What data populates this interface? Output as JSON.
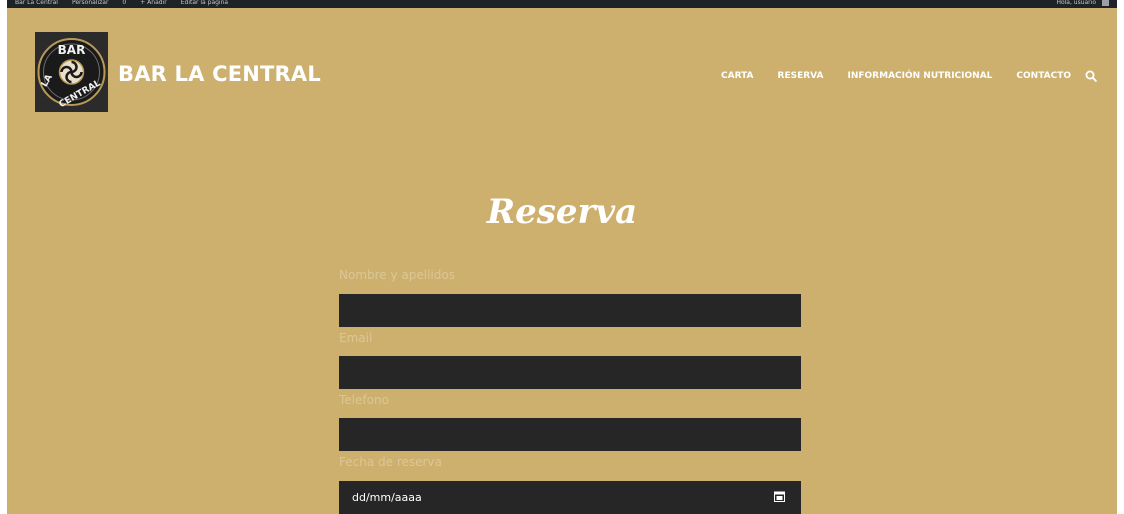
{
  "admin_bar": {
    "left_items": [
      "Bar La Central",
      "Personalizar",
      "0",
      "+ Añadir",
      "Editar la página"
    ],
    "right_text": "Hola, usuario"
  },
  "header": {
    "site_title": "BAR LA CENTRAL",
    "logo_text": "BAR LA CENTRAL",
    "nav": {
      "carta": "CARTA",
      "reserva": "RESERVA",
      "nutricional": "INFORMACIÓN NUTRICIONAL",
      "contacto": "CONTACTO"
    }
  },
  "page": {
    "title": "Reserva"
  },
  "form": {
    "name_label": "Nombre y apellidos",
    "name_value": "",
    "email_label": "Email",
    "email_value": "",
    "phone_label": "Telefono",
    "phone_value": "",
    "date_label": "Fecha de reserva",
    "date_value": "dd/mm/aaaa"
  },
  "colors": {
    "page_background": "#cdb06e",
    "input_background": "#262626",
    "label_color": "#dbc796",
    "text_white": "#ffffff"
  },
  "icons": {
    "search": "search-icon",
    "calendar": "calendar-icon"
  }
}
